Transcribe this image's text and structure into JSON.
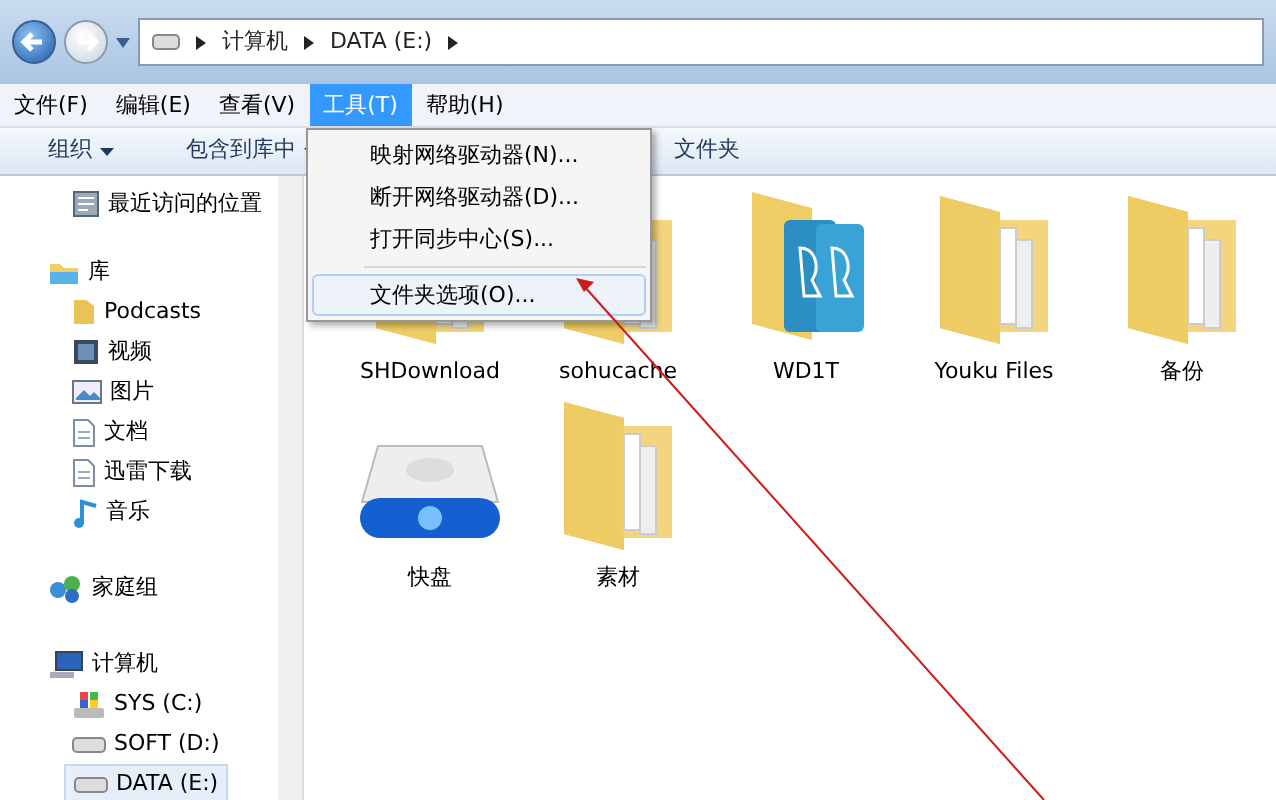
{
  "address_bar": {
    "path": [
      "计算机",
      "DATA (E:)"
    ]
  },
  "menu_bar": [
    {
      "label": "文件(F)",
      "selected": false
    },
    {
      "label": "编辑(E)",
      "selected": false
    },
    {
      "label": "查看(V)",
      "selected": false
    },
    {
      "label": "工具(T)",
      "selected": true
    },
    {
      "label": "帮助(H)",
      "selected": false
    }
  ],
  "toolbar": [
    {
      "label": "组织",
      "dropdown": true
    },
    {
      "label": "包含到库中",
      "dropdown": true
    },
    {
      "label": "文件夹",
      "dropdown": false
    }
  ],
  "open_menu": [
    {
      "label": "映射网络驱动器(N)...",
      "highlighted": false,
      "separator_before": false
    },
    {
      "label": "断开网络驱动器(D)...",
      "highlighted": false,
      "separator_before": false
    },
    {
      "label": "打开同步中心(S)...",
      "highlighted": false,
      "separator_before": false
    },
    {
      "label": "文件夹选项(O)...",
      "highlighted": true,
      "separator_before": true
    }
  ],
  "sidebar": {
    "sections": [
      {
        "items": [
          {
            "label": "最近访问的位置",
            "kind": "recent",
            "selected": false
          }
        ]
      },
      {
        "label": "库",
        "kind": "library",
        "children": [
          {
            "label": "Podcasts",
            "kind": "folder",
            "selected": false
          },
          {
            "label": "视频",
            "kind": "video",
            "selected": false
          },
          {
            "label": "图片",
            "kind": "picture",
            "selected": false
          },
          {
            "label": "文档",
            "kind": "document",
            "selected": false
          },
          {
            "label": "迅雷下载",
            "kind": "document",
            "selected": false
          },
          {
            "label": "音乐",
            "kind": "music",
            "selected": false
          }
        ]
      },
      {
        "label": "家庭组",
        "kind": "homegroup"
      },
      {
        "label": "计算机",
        "kind": "computer",
        "children": [
          {
            "label": "SYS (C:)",
            "kind": "sysdrive",
            "selected": false
          },
          {
            "label": "SOFT (D:)",
            "kind": "drive",
            "selected": false
          },
          {
            "label": "DATA (E:)",
            "kind": "drive",
            "selected": true
          }
        ]
      }
    ]
  },
  "files": [
    {
      "name": "SHDownload",
      "kind": "folder"
    },
    {
      "name": "sohucache",
      "kind": "folder"
    },
    {
      "name": "WD1T",
      "kind": "appfolder"
    },
    {
      "name": "Youku Files",
      "kind": "folder"
    },
    {
      "name": "备份",
      "kind": "folder"
    },
    {
      "name": "快盘",
      "kind": "drive"
    },
    {
      "name": "素材",
      "kind": "folder"
    }
  ]
}
